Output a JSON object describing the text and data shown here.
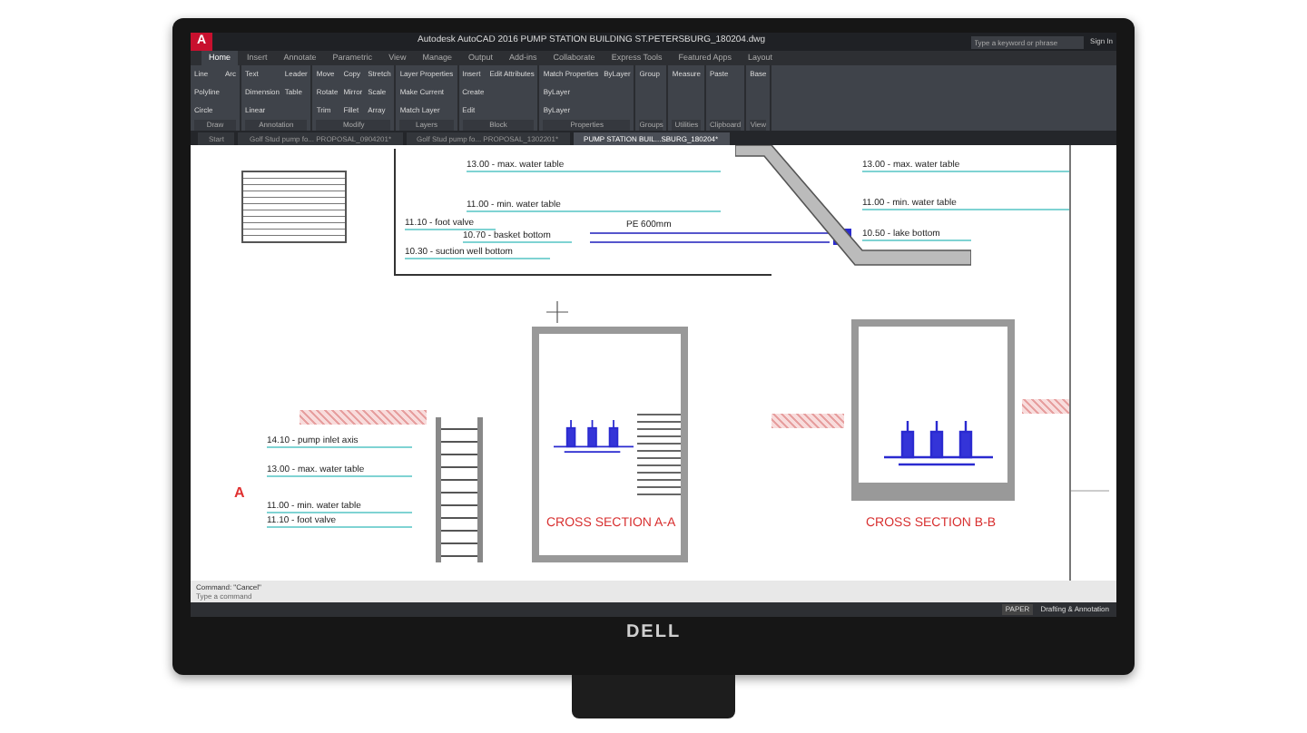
{
  "window": {
    "app_icon": "A",
    "title": "Autodesk AutoCAD 2016   PUMP STATION BUILDING ST.PETERSBURG_180204.dwg",
    "search": {
      "placeholder": "Type a keyword or phrase"
    },
    "sign_in": "Sign In"
  },
  "ribbon_tabs": [
    {
      "label": "Home",
      "selected": true
    },
    {
      "label": "Insert",
      "selected": false
    },
    {
      "label": "Annotate",
      "selected": false
    },
    {
      "label": "Parametric",
      "selected": false
    },
    {
      "label": "View",
      "selected": false
    },
    {
      "label": "Manage",
      "selected": false
    },
    {
      "label": "Output",
      "selected": false
    },
    {
      "label": "Add-ins",
      "selected": false
    },
    {
      "label": "Collaborate",
      "selected": false
    },
    {
      "label": "Express Tools",
      "selected": false
    },
    {
      "label": "Featured Apps",
      "selected": false
    },
    {
      "label": "Layout",
      "selected": false
    }
  ],
  "ribbon_groups": [
    {
      "name": "Draw",
      "tools": [
        "Line",
        "Polyline",
        "Circle",
        "Arc"
      ]
    },
    {
      "name": "Annotation",
      "tools": [
        "Text",
        "Dimension",
        "Linear",
        "Leader",
        "Table"
      ]
    },
    {
      "name": "Modify",
      "tools": [
        "Move",
        "Rotate",
        "Trim",
        "Copy",
        "Mirror",
        "Fillet",
        "Stretch",
        "Scale",
        "Array"
      ]
    },
    {
      "name": "Layers",
      "tools": [
        "Layer Properties",
        "Make Current",
        "Match Layer"
      ]
    },
    {
      "name": "Block",
      "tools": [
        "Insert",
        "Create",
        "Edit",
        "Edit Attributes"
      ]
    },
    {
      "name": "Properties",
      "tools": [
        "Match Properties",
        "ByLayer",
        "ByLayer",
        "ByLayer"
      ]
    },
    {
      "name": "Groups",
      "tools": [
        "Group"
      ]
    },
    {
      "name": "Utilities",
      "tools": [
        "Measure"
      ]
    },
    {
      "name": "Clipboard",
      "tools": [
        "Paste"
      ]
    },
    {
      "name": "View",
      "tools": [
        "Base"
      ]
    }
  ],
  "file_tabs": [
    {
      "label": "Start",
      "selected": false
    },
    {
      "label": "Golf Stud pump fo... PROPOSAL_0904201*",
      "selected": false
    },
    {
      "label": "Golf Stud pump fo... PROPOSAL_1302201*",
      "selected": false
    },
    {
      "label": "PUMP STATION BUIL...SBURG_180204*",
      "selected": true
    }
  ],
  "drawing": {
    "upper_profile": [
      "13.00 - max. water table",
      "11.00 - min. water table",
      "11.10 - foot valve",
      "10.70 - basket bottom",
      "10.30 - suction well bottom"
    ],
    "pipe_label": "PE 600mm",
    "lake_profile": [
      "13.00 - max. water table",
      "11.00 - min. water table",
      "10.50 - lake bottom"
    ],
    "left_wall": [
      "14.10 - pump inlet axis",
      "13.00 - max. water table",
      "11.00 - min. water table",
      "11.10 - foot valve"
    ],
    "section_marker": "A",
    "section_titles": [
      "CROSS SECTION A-A",
      "CROSS SECTION B-B"
    ]
  },
  "command_line": {
    "history": "Command: \"Cancel\"",
    "placeholder": "Type a command"
  },
  "status_bar": {
    "space": "PAPER",
    "workspace": "Drafting & Annotation"
  },
  "brand": "DELL"
}
